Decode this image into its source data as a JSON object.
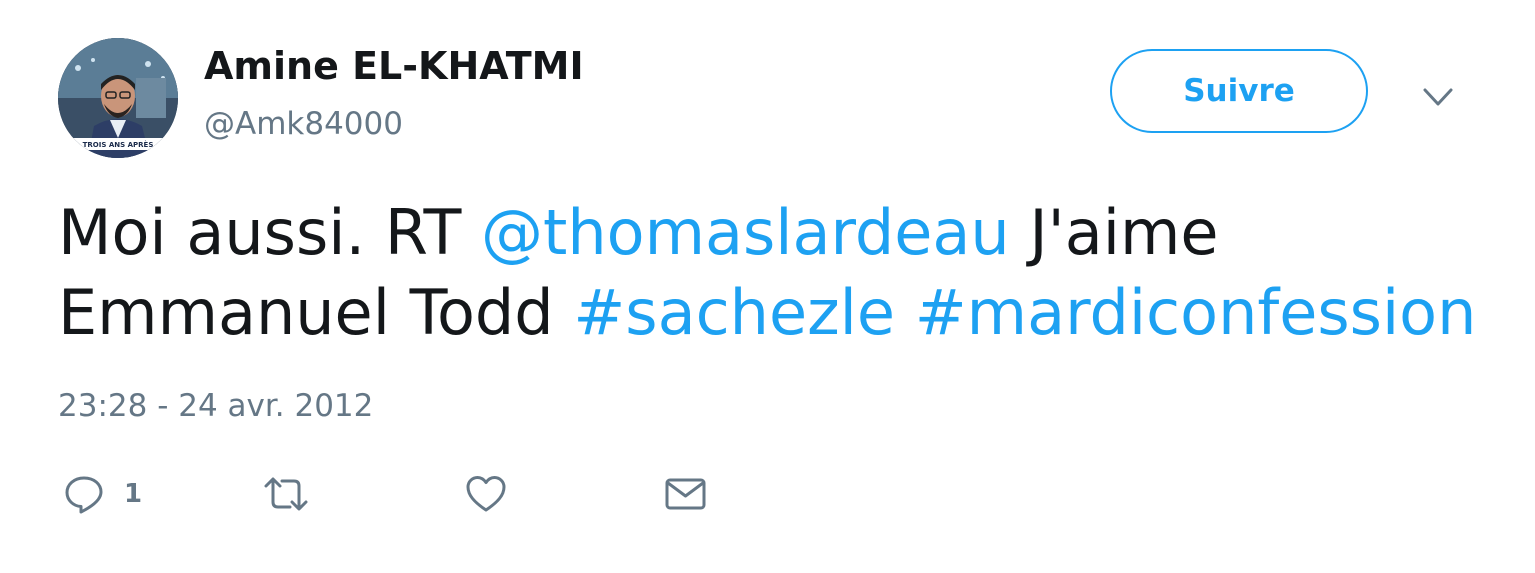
{
  "author": {
    "name": "Amine EL-KHATMI",
    "handle": "@Amk84000",
    "avatar_caption": "TROIS ANS APRÈS"
  },
  "follow_button": {
    "label": "Suivre"
  },
  "tweet": {
    "prefix": "Moi aussi. RT ",
    "mention": "@thomaslardeau",
    "after_mention": " J'aime",
    "line2_text": "Emmanuel Todd ",
    "hashtag1": "#sachezle",
    "space": " ",
    "hashtag2": "#mardiconfession",
    "timestamp": "23:28 - 24 avr. 2012"
  },
  "actions": {
    "reply_count": "1"
  },
  "icons": {
    "caret": "chevron-down-icon",
    "reply": "reply-icon",
    "retweet": "retweet-icon",
    "like": "heart-icon",
    "message": "envelope-icon"
  },
  "colors": {
    "accent": "#1da1f2",
    "text": "#14171a",
    "secondary": "#657786"
  }
}
